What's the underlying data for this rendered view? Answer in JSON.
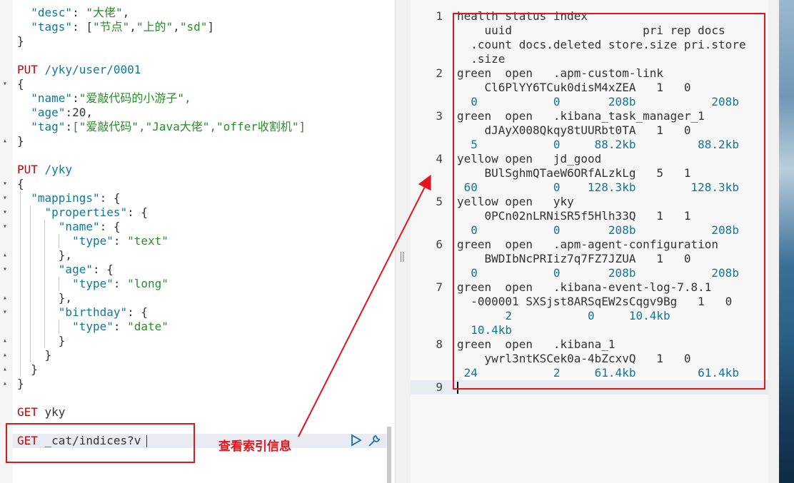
{
  "left": {
    "l1": "\"desc\": \"大佬\",",
    "l2": "\"tags\": [\"节点\",\"上的\",\"sd\"]",
    "l3": "}",
    "put1_method": "PUT",
    "put1_path": " /yky/user/0001",
    "brace_open": "{",
    "name_key": "\"name\"",
    "name_val": "\"爱敲代码的小游子\",",
    "age_key": "\"age\"",
    "age_val": "20,",
    "tag_key": "\"tag\"",
    "tag_val": "[\"爱敲代码\",\"Java大佬\",\"offer收割机\"]",
    "brace_close": "}",
    "put2_method": "PUT",
    "put2_path": " /yky",
    "mappings_key": "\"mappings\"",
    "properties_key": "\"properties\"",
    "name_field": "\"name\"",
    "age_field": "\"age\"",
    "birthday_field": "\"birthday\"",
    "type_key": "\"type\"",
    "type_text": "\"text\"",
    "type_long": "\"long\"",
    "type_date": "\"date\"",
    "get1_method": "GET",
    "get1_path": " yky",
    "get2_method": "GET",
    "get2_path": " _cat/indices?v"
  },
  "annotation": "查看索引信息",
  "right": {
    "line_numbers": [
      "1",
      "2",
      "3",
      "4",
      "5",
      "6",
      "7",
      "8",
      "9"
    ],
    "lines": [
      "health status index",
      "    uuid                   pri rep docs",
      "  .count docs.deleted store.size pri.store",
      "  .size",
      "green  open   .apm-custom-link",
      "    Cl6PlYY6TCuk0disM4xZEA   1   0",
      "  0           0       208b           208b",
      "green  open   .kibana_task_manager_1",
      "    dJAyX008Qkqy8tUURbt0TA   1   0",
      "  5           0     88.2kb         88.2kb",
      "yellow open   jd_good",
      "    BUlSghmQTaeW6ORfALzkLg   5   1",
      " 60           0    128.3kb        128.3kb",
      "yellow open   yky",
      "    0PCn02nLRNiSR5f5Hlh33Q   1   1",
      "  0           0       208b           208b",
      "green  open   .apm-agent-configuration",
      "    BWDIbNcPRIiz7q7FZ7JZUA   1   0",
      "  0           0       208b           208b",
      "green  open   .kibana-event-log-7.8.1",
      "  -000001 SXSjst8ARSqEW2sCqgv9Bg   1   0",
      "       2           0     10.4kb",
      "  10.4kb",
      "green  open   .kibana_1",
      "    ywrl3ntKSCek0a-4bZcxvQ   1   0",
      " 24           2     61.4kb         61.4kb"
    ]
  }
}
